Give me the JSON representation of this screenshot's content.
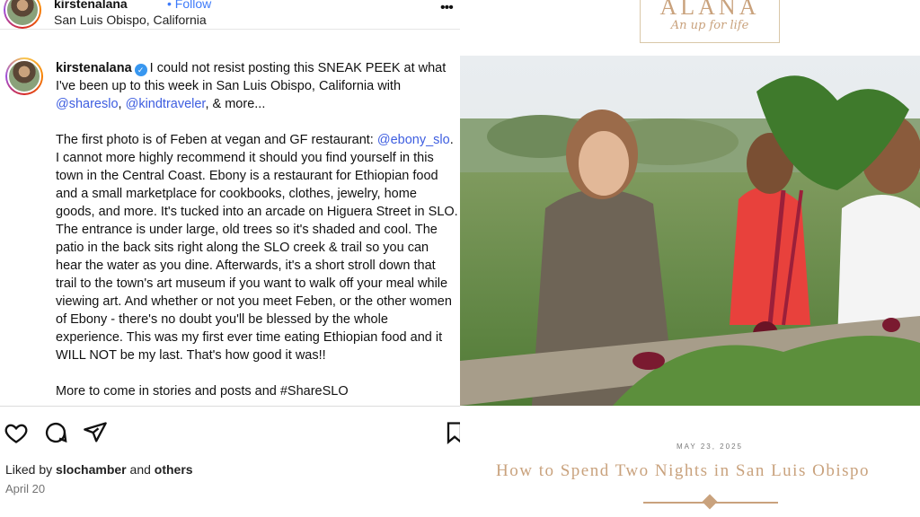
{
  "instagram": {
    "header": {
      "username": "kirstenalana",
      "follow": "• Follow",
      "location": "San Luis Obispo, California",
      "more": "•••"
    },
    "caption": {
      "username": "kirstenalana",
      "intro": "I could not resist posting this SNEAK PEEK at what I've been up to this week in San Luis Obispo, California with",
      "mention1": "@shareslo",
      "sep": ", ",
      "mention2": "@kindtraveler",
      "intro_end": ", & more...",
      "p2_start": "The first photo is of Feben at vegan and GF restaurant:",
      "mention3": "@ebony_slo",
      "p2_rest": ". I cannot more highly recommend it should you find yourself in this town in the Central Coast. Ebony is a restaurant for Ethiopian food and a small marketplace for cookbooks, clothes, jewelry, home goods, and more. It's tucked into an arcade on Higuera Street in SLO. The entrance is under large, old trees so it's shaded and cool. The patio in the back sits right along the SLO creek & trail so you can hear the water as you dine. Afterwards, it's a short stroll down that trail to the town's art museum if you want to walk off your meal while viewing art. And whether or not you meet Feben, or the other women of Ebony - there's no doubt you'll be blessed by the whole experience. This was my first ever time eating Ethiopian food and it WILL NOT be my last. That's how good it was!!",
      "p3_cut": "More to come in stories and posts and #ShareSLO"
    },
    "actions": {
      "like_icon": "heart-icon",
      "comment_icon": "comment-icon",
      "share_icon": "send-icon",
      "save_icon": "bookmark-icon"
    },
    "likes": {
      "prefix": "Liked by ",
      "user": "slochamber",
      "middle": " and ",
      "others": "others"
    },
    "date": "April 20"
  },
  "blog": {
    "logo": {
      "name": "ALANA",
      "tagline": "An up for life"
    },
    "post_date": "MAY 23, 2025",
    "post_title": "How to Spend Two Nights in San Luis Obispo",
    "colors": {
      "accent": "#c9a27d",
      "link": "#3e5ee0"
    }
  }
}
